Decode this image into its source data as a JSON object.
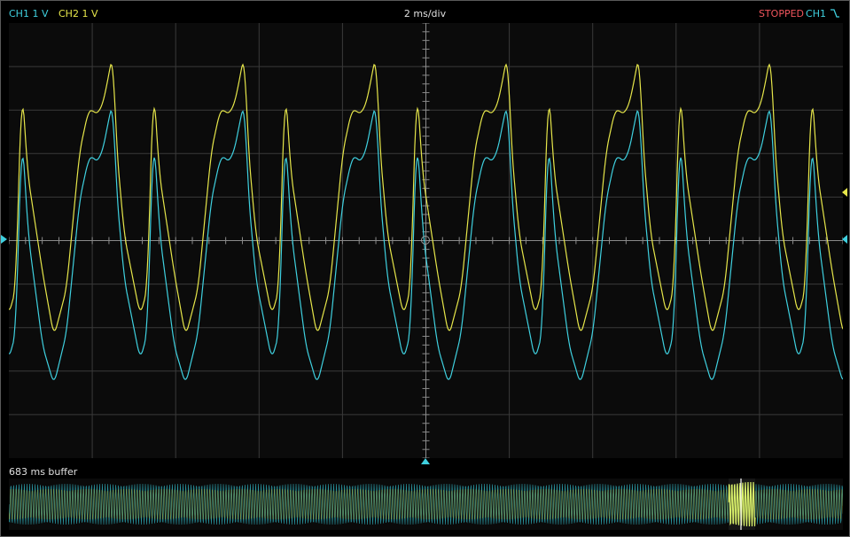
{
  "header": {
    "ch1_label": "CH1 1 V",
    "ch2_label": "CH2 1 V",
    "timebase": "2 ms/div",
    "status": "STOPPED",
    "trigger_source": "CH1"
  },
  "buffer": {
    "label": "683 ms buffer"
  },
  "colors": {
    "ch1": "#3fd0df",
    "ch2": "#e6e64a",
    "status": "#f0555c",
    "grid": "#3a3a3a",
    "axis": "#8a8a8a"
  },
  "icons": {
    "trigger_edge": "falling-edge-icon"
  }
}
